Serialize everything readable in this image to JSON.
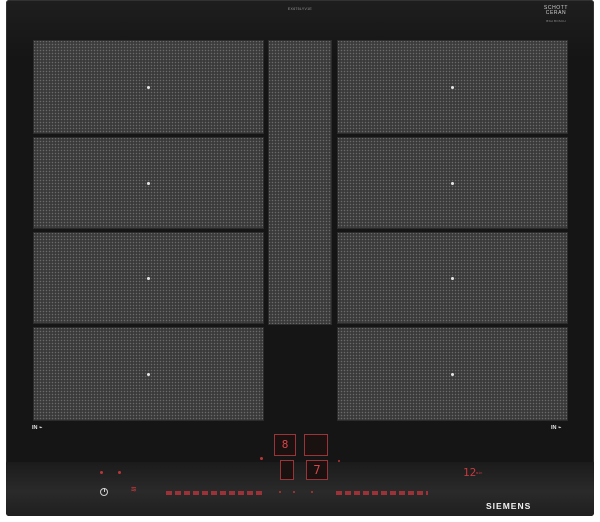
{
  "hob": {
    "top_code": "EX675LYV1E",
    "logo_line1": "SCHOTT",
    "logo_line2": "CERAN",
    "logo_sub": "BSH BOSCH",
    "left_in_label": "IN",
    "right_in_label": "IN",
    "brand": "SIEMENS"
  },
  "controls": {
    "zone_display": "8",
    "power_level": "7",
    "timer_display": "12",
    "timer_unit": "min"
  },
  "colors": {
    "glass": "#151515",
    "zone_grid": "#3a3a3a",
    "control_red": "#c9393e",
    "brand_white": "#f2f2f2"
  }
}
